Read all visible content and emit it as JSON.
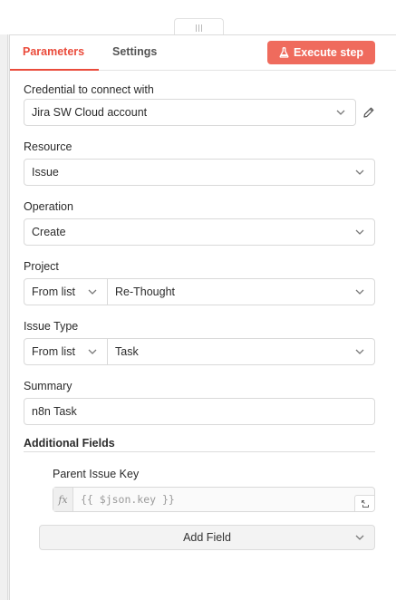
{
  "tabs": [
    {
      "label": "Parameters",
      "active": true
    },
    {
      "label": "Settings",
      "active": false
    }
  ],
  "execute_button": {
    "label": "Execute step",
    "icon": "flask-icon"
  },
  "credential": {
    "label": "Credential to connect with",
    "value": "Jira SW Cloud account"
  },
  "resource": {
    "label": "Resource",
    "value": "Issue"
  },
  "operation": {
    "label": "Operation",
    "value": "Create"
  },
  "project": {
    "label": "Project",
    "mode": "From list",
    "value": "Re-Thought"
  },
  "issue_type": {
    "label": "Issue Type",
    "mode": "From list",
    "value": "Task"
  },
  "summary": {
    "label": "Summary",
    "value": "n8n Task"
  },
  "additional_fields": {
    "title": "Additional Fields",
    "parent_issue_key": {
      "label": "Parent Issue Key",
      "expression": "{{ $json.key }}"
    },
    "add_field_label": "Add Field"
  },
  "colors": {
    "accent": "#ea4b3b",
    "execute_bg": "#ef6b5d"
  }
}
